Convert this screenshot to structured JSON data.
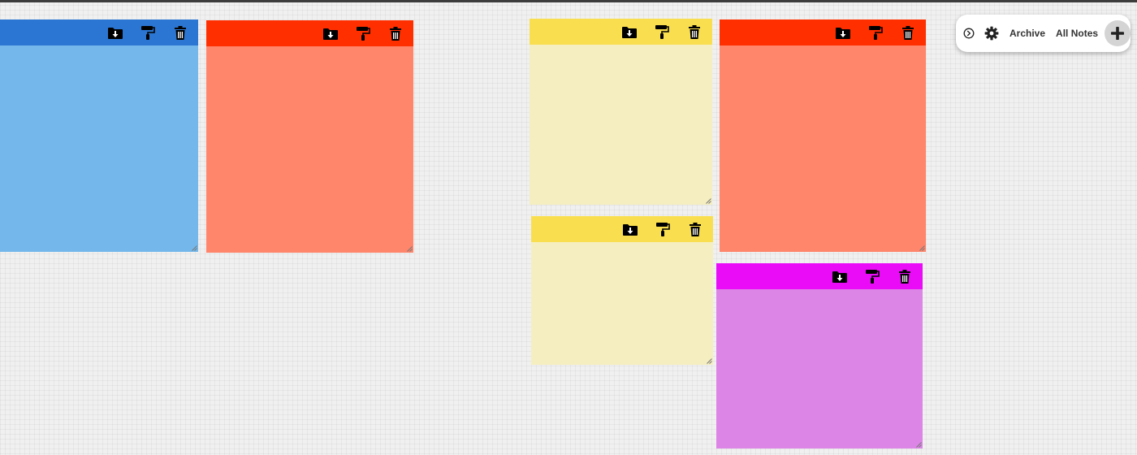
{
  "board": {
    "background": "#f0f0f0"
  },
  "notes": [
    {
      "header_color": "#2b76d2",
      "body_color": "#74b8eb",
      "content": "",
      "visible_icons": [
        "archive-icon",
        "paint-roller-icon",
        "trash-icon"
      ]
    },
    {
      "header_color": "#ff2f00",
      "body_color": "#ff856b",
      "content": "",
      "visible_icons": [
        "archive-icon",
        "paint-roller-icon",
        "trash-icon"
      ]
    },
    {
      "header_color": "#f9df4f",
      "body_color": "#f5eec0",
      "content": "",
      "visible_icons": [
        "archive-icon",
        "paint-roller-icon",
        "trash-icon"
      ]
    },
    {
      "header_color": "#f9df4f",
      "body_color": "#f5eec0",
      "content": "",
      "visible_icons": [
        "archive-icon",
        "paint-roller-icon",
        "trash-icon"
      ]
    },
    {
      "header_color": "#ff2f00",
      "body_color": "#ff856b",
      "content": "",
      "visible_icons": [
        "archive-icon",
        "paint-roller-icon",
        "trash-icon"
      ]
    },
    {
      "header_color": "#ea0cf7",
      "body_color": "#dd85e6",
      "content": "",
      "visible_icons": [
        "archive-icon",
        "paint-roller-icon",
        "trash-icon"
      ]
    }
  ],
  "toolbar": {
    "archive_label": "Archive",
    "all_notes_label": "All Notes",
    "icons": [
      "play-circle-icon",
      "gear-icon",
      "plus-icon"
    ]
  }
}
